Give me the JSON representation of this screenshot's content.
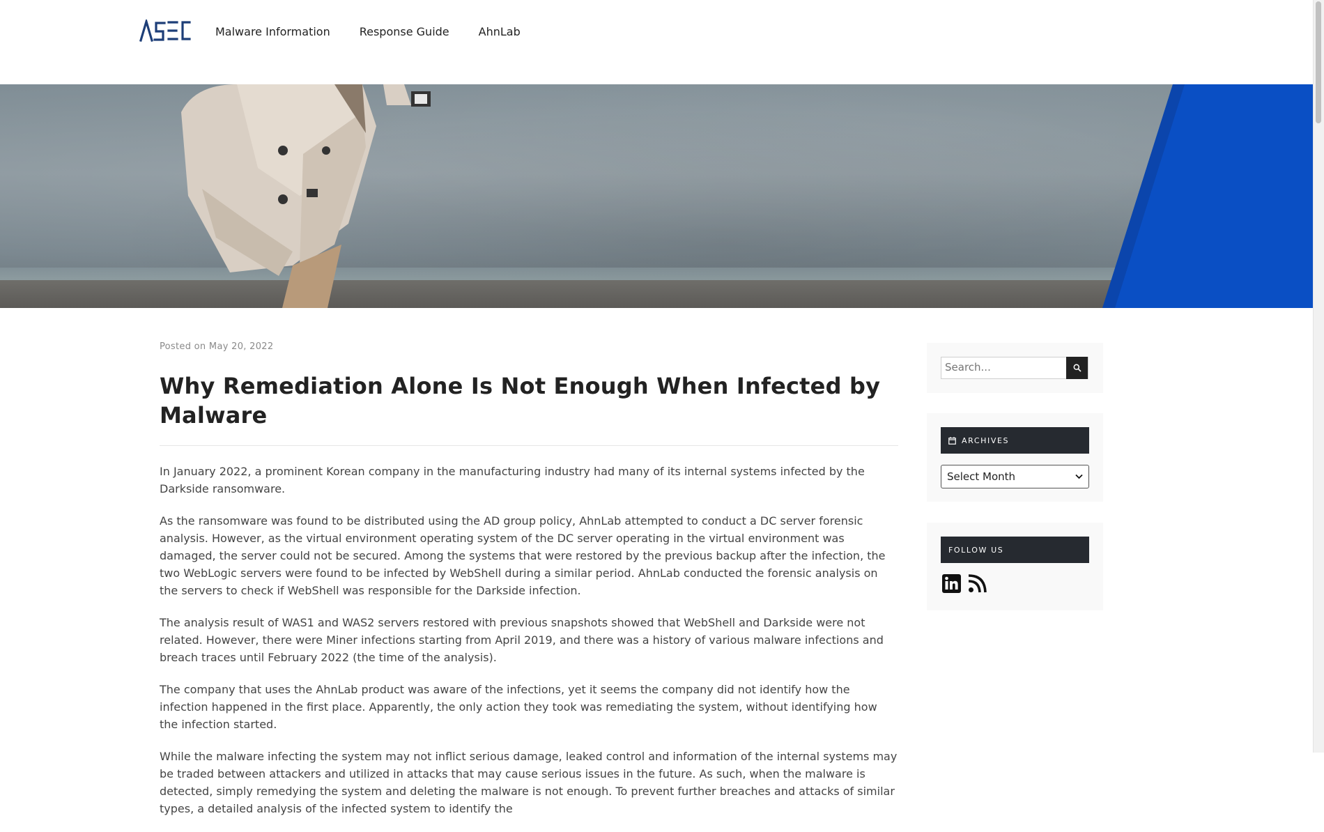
{
  "header": {
    "logo_text": "ASEC",
    "nav": [
      "Malware Information",
      "Response Guide",
      "AhnLab"
    ]
  },
  "article": {
    "posted_prefix": "Posted on",
    "posted_date": "May 20, 2022",
    "title": "Why Remediation Alone Is Not Enough When Infected by Malware",
    "paragraphs": [
      "In January 2022, a prominent Korean company in the manufacturing industry had many of its internal systems infected by the Darkside ransomware.",
      "As the ransomware was found to be distributed using the AD group policy, AhnLab attempted to conduct a DC server forensic analysis. However, as the virtual environment operating system of the DC server operating in the virtual environment was damaged, the server could not be secured. Among the systems that were restored by the previous backup after the infection, the two WebLogic servers were found to be infected by WebShell during a similar period. AhnLab conducted the forensic analysis on the servers to check if WebShell was responsible for the Darkside infection.",
      "The analysis result of WAS1 and WAS2 servers restored with previous snapshots showed that WebShell and Darkside were not related. However, there were Miner infections starting from April 2019, and there was a history of various malware infections and breach traces until February 2022 (the time of the analysis).",
      "The company that uses the AhnLab product was aware of the infections, yet it seems the company did not identify how the infection happened in the first place. Apparently, the only action they took was remediating the system, without identifying how the infection started.",
      "While the malware infecting the system may not inflict serious damage, leaked control and information of the internal systems may be traded between attackers and utilized in attacks that may cause serious issues in the future. As such, when the malware is detected, simply remedying the system and deleting the malware is not enough. To prevent further breaches and attacks of similar types, a detailed analysis of the infected system to identify the"
    ]
  },
  "sidebar": {
    "search_placeholder": "Search...",
    "archives_title": "ARCHIVES",
    "archives_select": "Select Month",
    "follow_title": "FOLLOW US",
    "social": [
      "linkedin-icon",
      "rss-icon"
    ]
  },
  "colors": {
    "widget_header_bg": "#262a30",
    "hero_blue": "#0a4fc4"
  }
}
